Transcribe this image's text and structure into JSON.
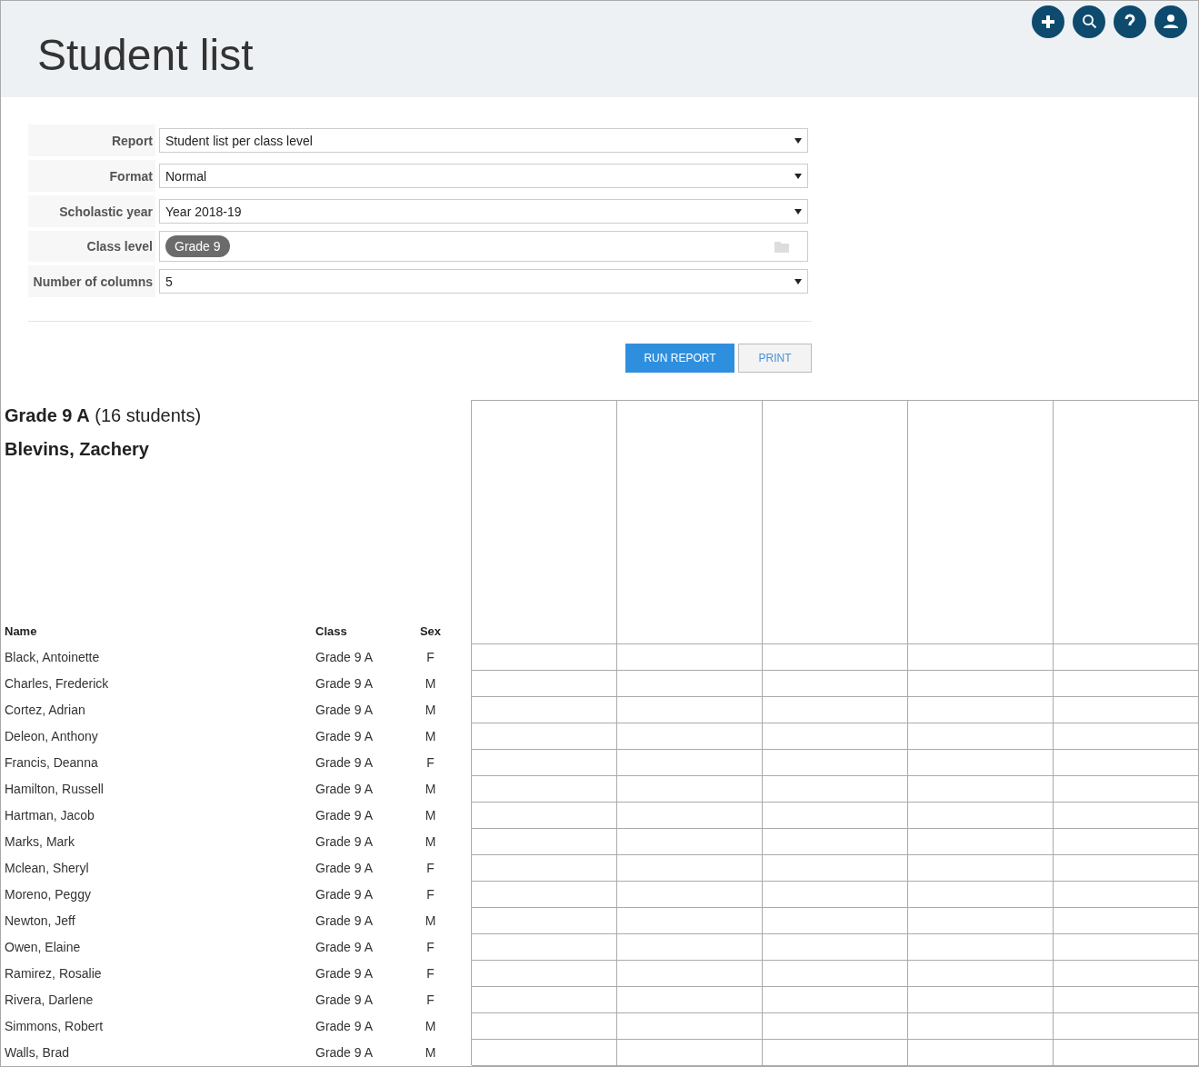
{
  "header": {
    "title": "Student list"
  },
  "form": {
    "fields": [
      {
        "label": "Report",
        "kind": "select",
        "value": "Student list per class level"
      },
      {
        "label": "Format",
        "kind": "select",
        "value": "Normal"
      },
      {
        "label": "Scholastic year",
        "kind": "select",
        "value": "Year 2018-19"
      },
      {
        "label": "Class level",
        "kind": "tags",
        "tags": [
          "Grade 9"
        ]
      },
      {
        "label": "Number of columns",
        "kind": "select",
        "value": "5"
      }
    ],
    "buttons": [
      {
        "label": "RUN REPORT",
        "kind": "primary"
      },
      {
        "label": "PRINT",
        "kind": "secondary"
      }
    ]
  },
  "report": {
    "group": "Grade 9 A",
    "count": "(16 students)",
    "subtitle": "Blevins, Zachery",
    "columns": [
      "Name",
      "Class",
      "Sex"
    ],
    "rows": [
      {
        "name": "Black, Antoinette",
        "class": "Grade 9 A",
        "sex": "F"
      },
      {
        "name": "Charles, Frederick",
        "class": "Grade 9 A",
        "sex": "M"
      },
      {
        "name": "Cortez, Adrian",
        "class": "Grade 9 A",
        "sex": "M"
      },
      {
        "name": "Deleon, Anthony",
        "class": "Grade 9 A",
        "sex": "M"
      },
      {
        "name": "Francis, Deanna",
        "class": "Grade 9 A",
        "sex": "F"
      },
      {
        "name": "Hamilton, Russell",
        "class": "Grade 9 A",
        "sex": "M"
      },
      {
        "name": "Hartman, Jacob",
        "class": "Grade 9 A",
        "sex": "M"
      },
      {
        "name": "Marks, Mark",
        "class": "Grade 9 A",
        "sex": "M"
      },
      {
        "name": "Mclean, Sheryl",
        "class": "Grade 9 A",
        "sex": "F"
      },
      {
        "name": "Moreno, Peggy",
        "class": "Grade 9 A",
        "sex": "F"
      },
      {
        "name": "Newton, Jeff",
        "class": "Grade 9 A",
        "sex": "M"
      },
      {
        "name": "Owen, Elaine",
        "class": "Grade 9 A",
        "sex": "F"
      },
      {
        "name": "Ramirez, Rosalie",
        "class": "Grade 9 A",
        "sex": "F"
      },
      {
        "name": "Rivera, Darlene",
        "class": "Grade 9 A",
        "sex": "F"
      },
      {
        "name": "Simmons, Robert",
        "class": "Grade 9 A",
        "sex": "M"
      },
      {
        "name": "Walls, Brad",
        "class": "Grade 9 A",
        "sex": "M"
      }
    ]
  }
}
